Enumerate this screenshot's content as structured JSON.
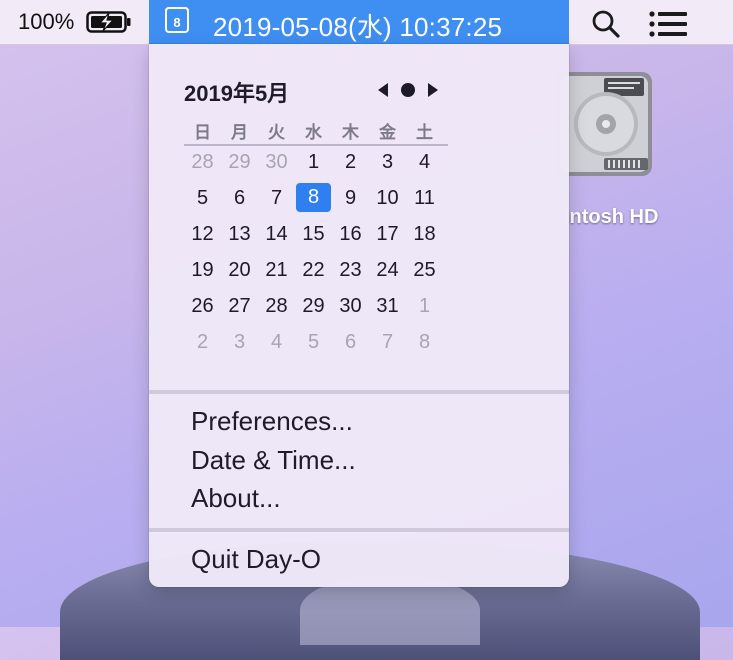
{
  "menubar": {
    "battery_percent": "100%",
    "clock_icon_day": "8",
    "clock_text": "2019-05-08(水) 10:37:25",
    "accent_color": "#3f8ef2"
  },
  "desktop": {
    "disk_label": "intosh HD"
  },
  "calendar": {
    "title": "2019年5月",
    "weekdays": [
      "日",
      "月",
      "火",
      "水",
      "木",
      "金",
      "土"
    ],
    "weeks": [
      [
        "28",
        "29",
        "30",
        "1",
        "2",
        "3",
        "4"
      ],
      [
        "5",
        "6",
        "7",
        "8",
        "9",
        "10",
        "11"
      ],
      [
        "12",
        "13",
        "14",
        "15",
        "16",
        "17",
        "18"
      ],
      [
        "19",
        "20",
        "21",
        "22",
        "23",
        "24",
        "25"
      ],
      [
        "26",
        "27",
        "28",
        "29",
        "30",
        "31",
        "1"
      ],
      [
        "2",
        "3",
        "4",
        "5",
        "6",
        "7",
        "8"
      ]
    ],
    "selected_day": "8"
  },
  "menu": {
    "preferences": "Preferences...",
    "date_time": "Date & Time...",
    "about": "About...",
    "quit": "Quit Day-O"
  }
}
